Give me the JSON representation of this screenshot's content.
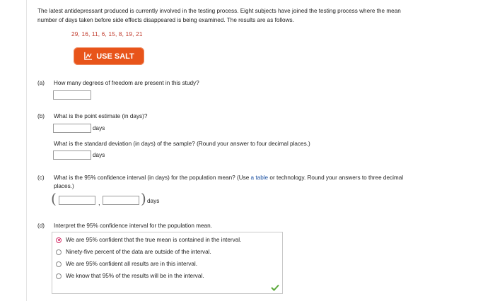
{
  "intro": {
    "line1": "The latest antidepressant produced is currently involved in the testing process. Eight subjects have joined the testing process where the mean",
    "line2": "number of days taken before side effects disappeared is being examined. The results are as follows."
  },
  "data_values": "29, 16, 11, 6, 15, 8, 19, 21",
  "salt_button": {
    "label": "USE SALT",
    "icon": "chart-line-icon",
    "color": "#e8541a"
  },
  "part_a": {
    "label": "(a)",
    "question": "How many degrees of freedom are present in this study?",
    "answer": ""
  },
  "part_b": {
    "label": "(b)",
    "question1": "What is the point estimate (in days)?",
    "unit1": "days",
    "answer1": "",
    "question2": "What is the standard deviation (in days) of the sample? (Round your answer to four decimal places.)",
    "unit2": "days",
    "answer2": ""
  },
  "part_c": {
    "label": "(c)",
    "question_pre": "What is the 95% confidence interval (in days) for the population mean? (Use",
    "link_text": "a table",
    "question_post": "or technology. Round your answers to three decimal",
    "question_line2": "places.)",
    "open_paren": "(",
    "comma": ",",
    "close_paren": ")",
    "unit": "days",
    "lower": "",
    "upper": ""
  },
  "part_d": {
    "label": "(d)",
    "question": "Interpret the 95% confidence interval for the population mean.",
    "options": [
      {
        "text": "We are 95% confident that the true mean is contained in the interval.",
        "selected": true
      },
      {
        "text": "Ninety-five percent of the data are outside of the interval.",
        "selected": false
      },
      {
        "text": "We are 95% confident all results are in this interval.",
        "selected": false
      },
      {
        "text": "We know that 95% of the results will be in the interval.",
        "selected": false
      }
    ],
    "status_icon": "checkmark-icon",
    "status_color": "#5aa83a"
  }
}
